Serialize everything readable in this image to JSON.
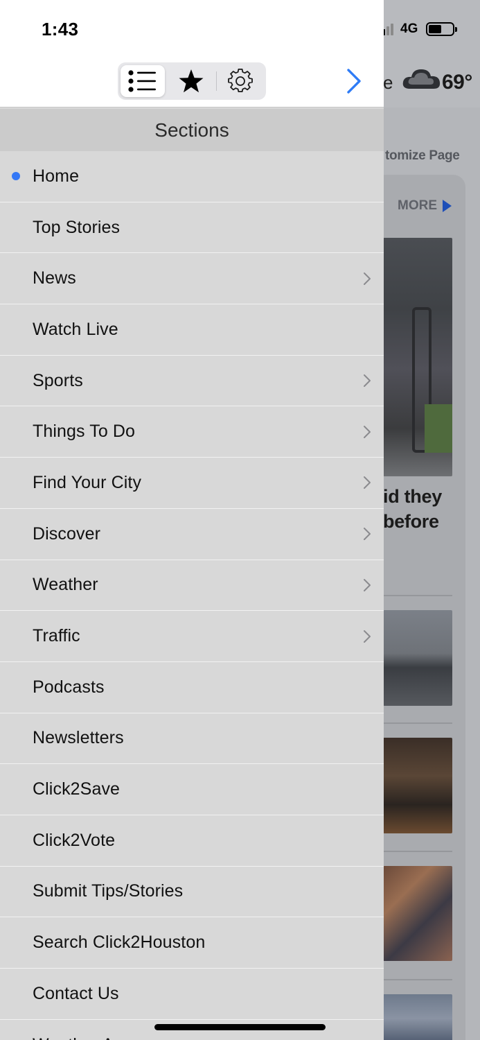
{
  "status_bar": {
    "time": "1:43",
    "network": "4G"
  },
  "toolbar": {
    "tabs": [
      {
        "icon": "list-icon",
        "selected": true
      },
      {
        "icon": "star-icon",
        "selected": false
      },
      {
        "icon": "gear-icon",
        "selected": false
      }
    ],
    "forward_icon": "chevron-right-icon"
  },
  "menu": {
    "title": "Sections",
    "items": [
      {
        "label": "Home",
        "active": true,
        "has_children": false
      },
      {
        "label": "Top Stories",
        "active": false,
        "has_children": false
      },
      {
        "label": "News",
        "active": false,
        "has_children": true
      },
      {
        "label": "Watch Live",
        "active": false,
        "has_children": false
      },
      {
        "label": "Sports",
        "active": false,
        "has_children": true
      },
      {
        "label": "Things To Do",
        "active": false,
        "has_children": true
      },
      {
        "label": "Find Your City",
        "active": false,
        "has_children": true
      },
      {
        "label": "Discover",
        "active": false,
        "has_children": true
      },
      {
        "label": "Weather",
        "active": false,
        "has_children": true
      },
      {
        "label": "Traffic",
        "active": false,
        "has_children": true
      },
      {
        "label": "Podcasts",
        "active": false,
        "has_children": false
      },
      {
        "label": "Newsletters",
        "active": false,
        "has_children": false
      },
      {
        "label": "Click2Save",
        "active": false,
        "has_children": false
      },
      {
        "label": "Click2Vote",
        "active": false,
        "has_children": false
      },
      {
        "label": "Submit Tips/Stories",
        "active": false,
        "has_children": false
      },
      {
        "label": "Search Click2Houston",
        "active": false,
        "has_children": false
      },
      {
        "label": "Contact Us",
        "active": false,
        "has_children": false
      },
      {
        "label": "Weather A",
        "active": false,
        "has_children": false
      }
    ]
  },
  "background_page": {
    "header_fragment": "e",
    "temperature": "69°",
    "weather_icon": "cloud-icon",
    "customize_fragment": "tomize Page",
    "more_label": "MORE",
    "headline_fragment_1": "id they",
    "headline_fragment_2": "before"
  },
  "colors": {
    "accent": "#3478f6",
    "menu_background": "#d8d8d8",
    "section_header": "#cbcbcb"
  }
}
